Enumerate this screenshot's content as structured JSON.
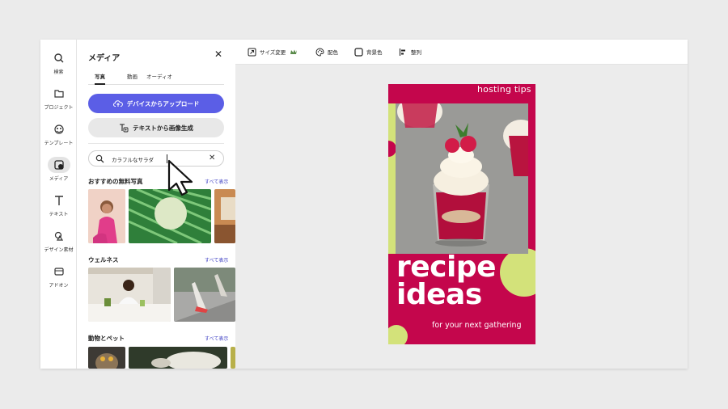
{
  "rail": {
    "items": [
      {
        "label": "検索",
        "icon": "search-icon"
      },
      {
        "label": "プロジェクト",
        "icon": "folder-icon"
      },
      {
        "label": "テンプレート",
        "icon": "template-icon"
      },
      {
        "label": "メディア",
        "icon": "media-icon",
        "active": true
      },
      {
        "label": "テキスト",
        "icon": "text-icon"
      },
      {
        "label": "デザイン素材",
        "icon": "shapes-icon"
      },
      {
        "label": "アドオン",
        "icon": "addon-icon"
      }
    ]
  },
  "panel": {
    "title": "メディア",
    "tabs": [
      {
        "label": "写真",
        "active": true
      },
      {
        "label": "動画"
      },
      {
        "label": "オーディオ"
      }
    ],
    "upload_button": "デバイスからアップロード",
    "generate_button": "テキストから画像生成",
    "search": {
      "value": "カラフルなサラダ",
      "placeholder": ""
    },
    "sections": [
      {
        "title": "おすすめの無料写真",
        "link": "すべて表示"
      },
      {
        "title": "ウェルネス",
        "link": "すべて表示"
      },
      {
        "title": "動物とペット",
        "link": "すべて表示"
      }
    ]
  },
  "toolbar": {
    "resize": "サイズ変更",
    "color": "配色",
    "background": "背景色",
    "align": "整列"
  },
  "design": {
    "tag": "hosting tips",
    "title_line1": "recipe",
    "title_line2": "ideas",
    "subtitle": "for your next gathering"
  },
  "colors": {
    "accent": "#5b5ee6",
    "design_bg": "#c4064c",
    "lime": "#d3e27a",
    "link": "#3d3fc4"
  }
}
